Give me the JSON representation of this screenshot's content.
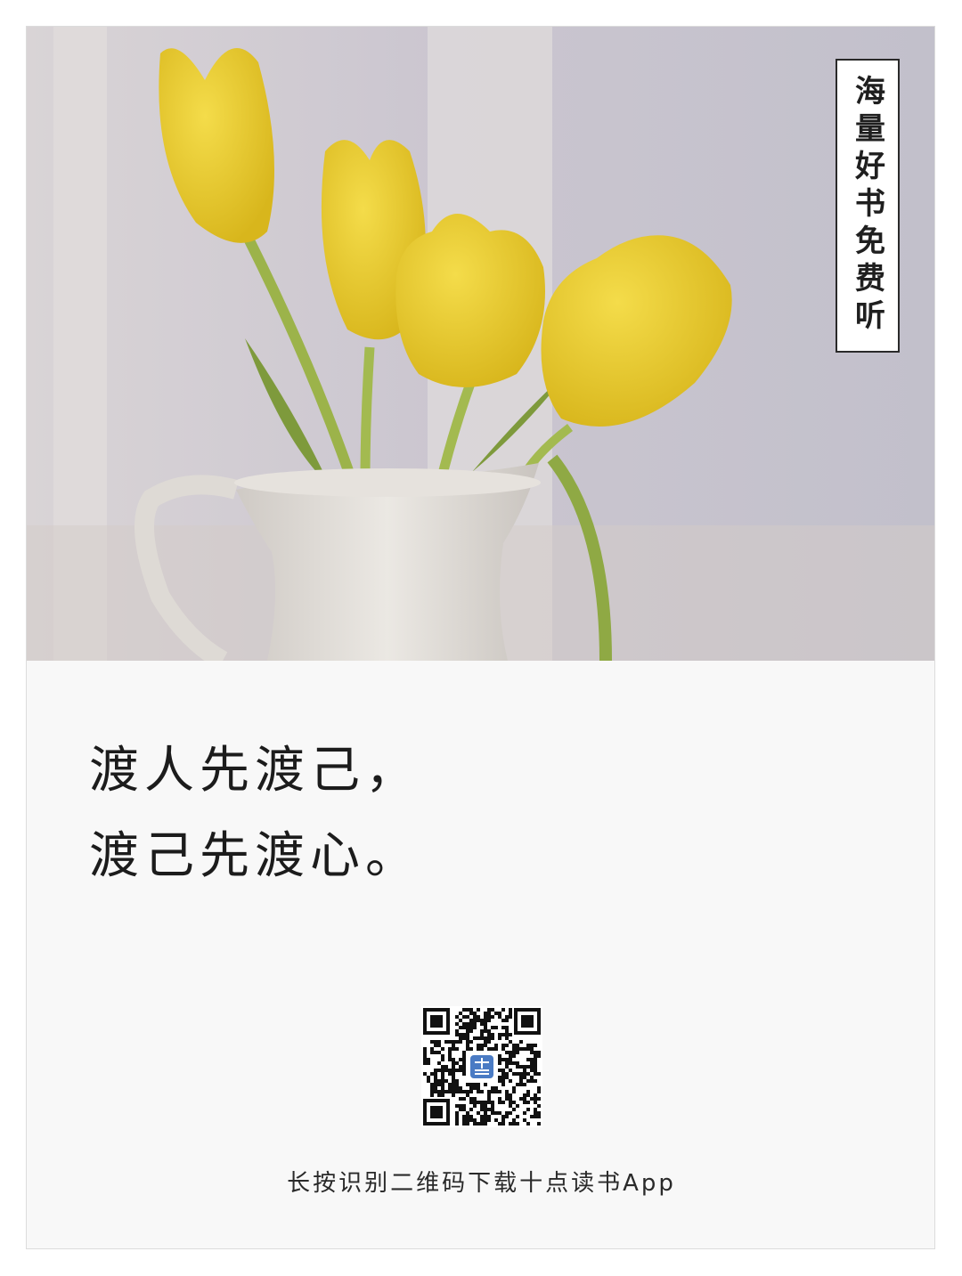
{
  "badge": {
    "text": "海量好书免费听"
  },
  "quote": {
    "line1": "渡人先渡己，",
    "line2": "渡己先渡心。"
  },
  "qr": {
    "center_logo_text": "十点读书"
  },
  "footer": {
    "caption": "长按识别二维码下载十点读书App"
  },
  "colors": {
    "card_background": "#f8f8f8",
    "tulip_yellow": "#e8c92a",
    "text_dark": "#1c1c1c",
    "qr_logo_blue": "#4a7bc4"
  }
}
